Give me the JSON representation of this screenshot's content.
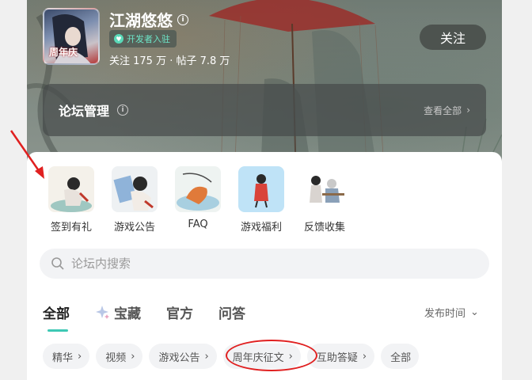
{
  "forum": {
    "name": "江湖悠悠",
    "badge": "开发者入驻",
    "stats": "关注 175 万 · 帖子 7.8 万",
    "follow_label": "关注",
    "avatar_stamp": "周年庆"
  },
  "management": {
    "title": "论坛管理",
    "view_all": "查看全部"
  },
  "shortcuts": [
    {
      "label": "签到有礼"
    },
    {
      "label": "游戏公告"
    },
    {
      "label": "FAQ"
    },
    {
      "label": "游戏福利"
    },
    {
      "label": "反馈收集"
    }
  ],
  "search": {
    "placeholder": "论坛内搜索"
  },
  "tabs": [
    {
      "label": "全部",
      "active": true
    },
    {
      "label": "宝藏",
      "icon": "sparkle-icon"
    },
    {
      "label": "官方"
    },
    {
      "label": "问答"
    }
  ],
  "sort": {
    "label": "发布时间"
  },
  "chips": [
    {
      "label": "精华"
    },
    {
      "label": "视频"
    },
    {
      "label": "游戏公告"
    },
    {
      "label": "周年庆征文"
    },
    {
      "label": "互助答疑"
    },
    {
      "label": "全部"
    }
  ],
  "colors": {
    "accent": "#3ec8b4",
    "annotation": "#e02020"
  }
}
